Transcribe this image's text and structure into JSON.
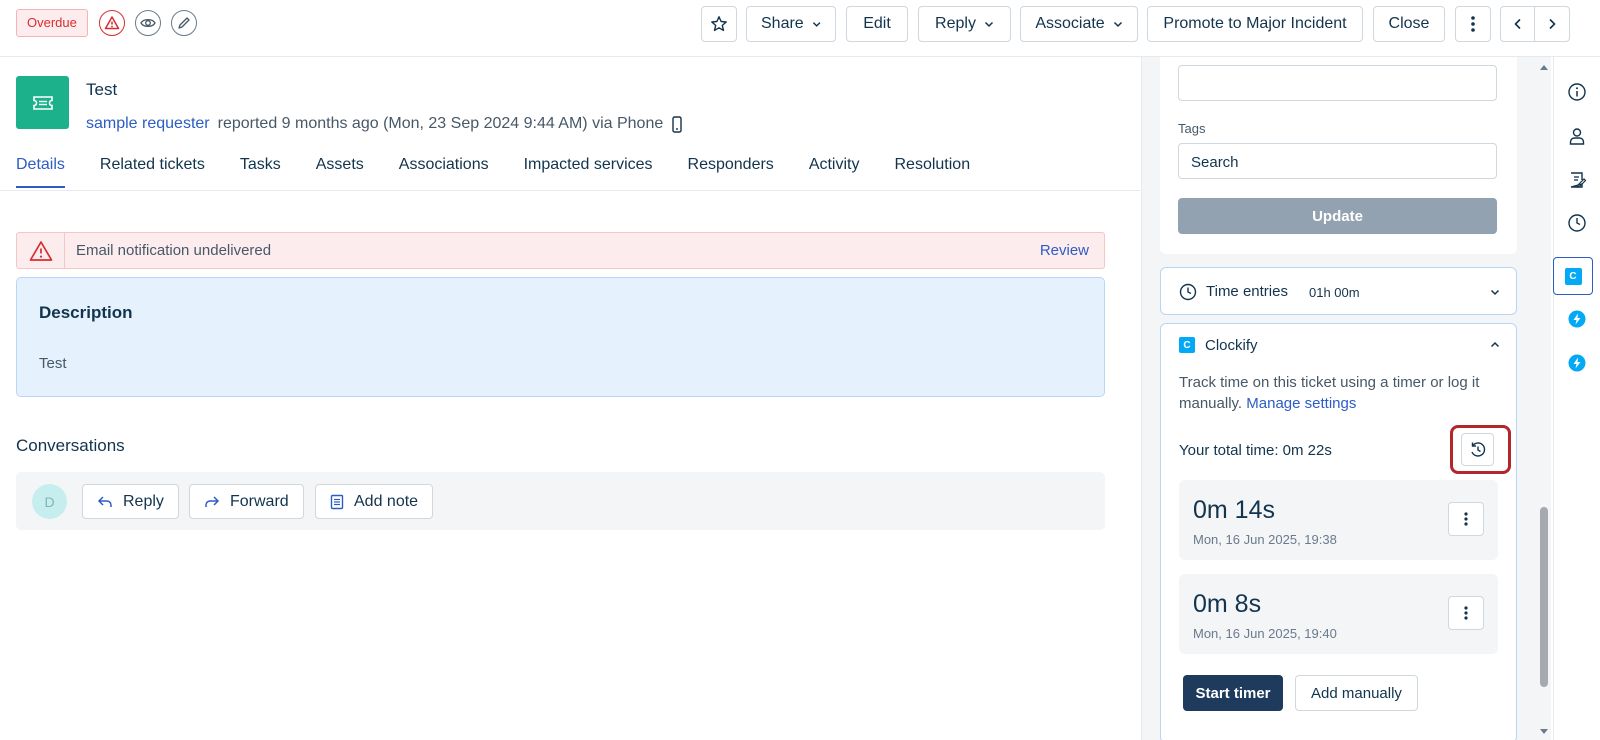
{
  "toolbar": {
    "status_badge": "Overdue",
    "share_label": "Share",
    "edit_label": "Edit",
    "reply_label": "Reply",
    "associate_label": "Associate",
    "promote_label": "Promote to Major Incident",
    "close_label": "Close"
  },
  "ticket": {
    "title": "Test",
    "requester": "sample requester",
    "reported": "reported 9 months ago (Mon, 23 Sep 2024 9:44 AM) via Phone"
  },
  "tabs": [
    "Details",
    "Related tickets",
    "Tasks",
    "Assets",
    "Associations",
    "Impacted services",
    "Responders",
    "Activity",
    "Resolution"
  ],
  "alert": {
    "text": "Email notification undelivered",
    "action": "Review"
  },
  "description": {
    "title": "Description",
    "body": "Test"
  },
  "conversations": {
    "title": "Conversations",
    "avatar_initial": "D",
    "reply_label": "Reply",
    "forward_label": "Forward",
    "add_note_label": "Add note"
  },
  "properties": {
    "tags_label": "Tags",
    "tags_placeholder": "Search",
    "update_label": "Update"
  },
  "time_entries": {
    "label": "Time entries",
    "total": "01h 00m"
  },
  "clockify": {
    "title": "Clockify",
    "logo_letter": "C",
    "description": "Track time on this ticket using a timer or log it manually.",
    "settings_link": "Manage settings",
    "total_label": "Your total time: 0m 22s",
    "entries": [
      {
        "duration": "0m 14s",
        "date": "Mon, 16 Jun 2025, 19:38"
      },
      {
        "duration": "0m 8s",
        "date": "Mon, 16 Jun 2025, 19:40"
      }
    ],
    "start_timer_label": "Start timer",
    "add_manually_label": "Add manually"
  },
  "colors": {
    "accent": "#2c5cc5",
    "ticket_icon": "#1cb08b",
    "clockify": "#03a9f4",
    "highlight_ring": "#b1272b",
    "start_timer_bg": "#1e3a5c"
  },
  "icons": [
    "warning-icon",
    "eye-icon",
    "pencil-icon",
    "star-icon",
    "kebab-icon",
    "chevron-left-icon",
    "chevron-right-icon",
    "ticket-icon",
    "phone-icon",
    "clock-icon",
    "history-icon",
    "info-icon",
    "person-icon",
    "notes-icon",
    "bolt-icon"
  ]
}
